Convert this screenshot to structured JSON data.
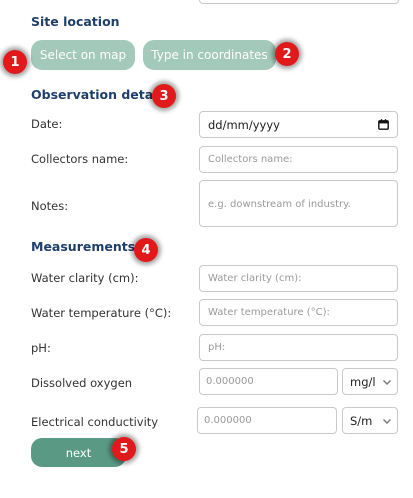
{
  "site_location": {
    "title": "Site location",
    "select_on_map_label": "Select on map",
    "type_in_coordinates_label": "Type in coordinates"
  },
  "observation_details": {
    "title": "Observation details",
    "date_label": "Date:",
    "date_value": "dd/mm/yyyy",
    "collectors_name_label": "Collectors name:",
    "collectors_name_placeholder": "Collectors name:",
    "notes_label": "Notes:",
    "notes_placeholder": "e.g. downstream of industry."
  },
  "measurements": {
    "title": "Measurements",
    "water_clarity_label": "Water clarity (cm):",
    "water_clarity_placeholder": "Water clarity (cm):",
    "water_temperature_label": "Water temperature (°C):",
    "water_temperature_placeholder": "Water temperature (°C):",
    "ph_label": "pH:",
    "ph_placeholder": "pH:",
    "dissolved_oxygen_label": "Dissolved oxygen",
    "dissolved_oxygen_placeholder": "0.000000",
    "dissolved_oxygen_unit": "mg/l",
    "electrical_conductivity_label": "Electrical conductivity",
    "electrical_conductivity_placeholder": "0.000000",
    "electrical_conductivity_unit": "S/m"
  },
  "next_label": "next",
  "badges": [
    "1",
    "2",
    "3",
    "4",
    "5"
  ],
  "colors": {
    "heading": "#1f3f6b",
    "mode_button": "#a3c9bb",
    "next_button": "#5a9a84",
    "badge": "#e2191b"
  }
}
